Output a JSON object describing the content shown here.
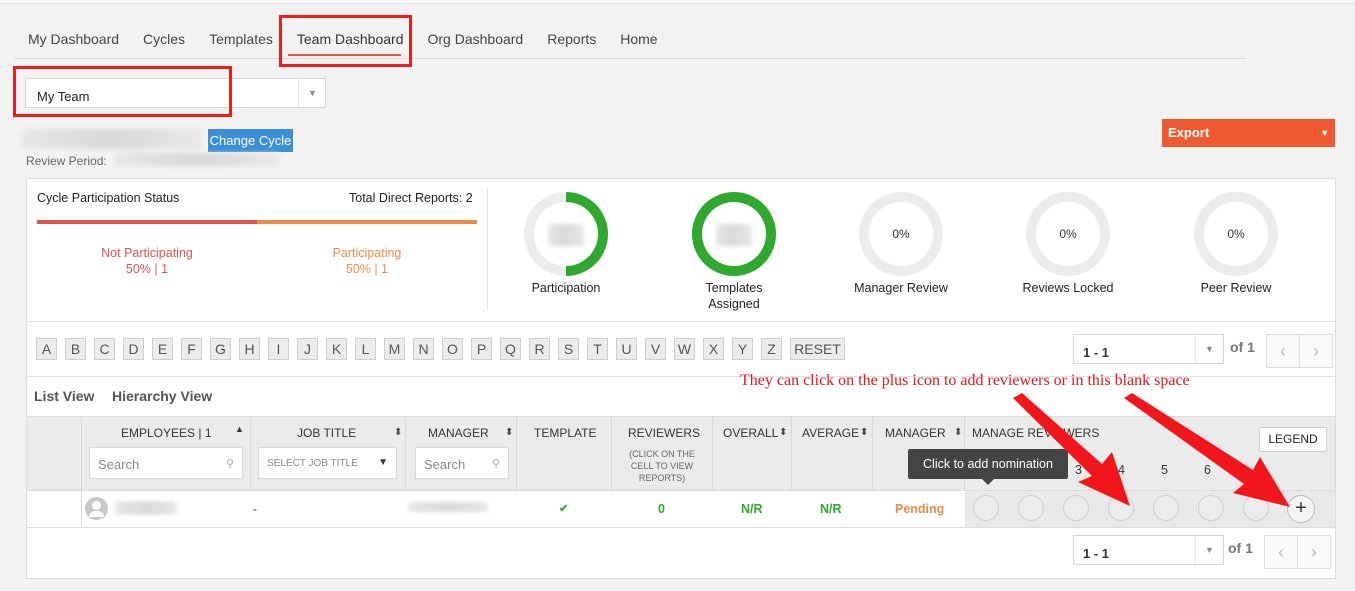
{
  "nav": {
    "tabs": [
      "My Dashboard",
      "Cycles",
      "Templates",
      "Team Dashboard",
      "Org Dashboard",
      "Reports",
      "Home"
    ],
    "active": "Team Dashboard"
  },
  "team_select": {
    "value": "My Team"
  },
  "cycle": {
    "change_label": "Change Cycle",
    "review_period_label": "Review Period:"
  },
  "export": {
    "label": "Export"
  },
  "participation": {
    "title": "Cycle Participation Status",
    "total": "Total Direct Reports: 2",
    "not_participating": {
      "label": "Not Participating",
      "value": "50% | 1"
    },
    "participating": {
      "label": "Participating",
      "value": "50% | 1"
    }
  },
  "stats": [
    {
      "label": "Participation",
      "value": "",
      "fill": 0.5
    },
    {
      "label": "Templates Assigned",
      "value": "",
      "fill": 1.0
    },
    {
      "label": "Manager Review",
      "value": "0%",
      "fill": 0
    },
    {
      "label": "Reviews Locked",
      "value": "0%",
      "fill": 0
    },
    {
      "label": "Peer Review",
      "value": "0%",
      "fill": 0
    }
  ],
  "letters": [
    "A",
    "B",
    "C",
    "D",
    "E",
    "F",
    "G",
    "H",
    "I",
    "J",
    "K",
    "L",
    "M",
    "N",
    "O",
    "P",
    "Q",
    "R",
    "S",
    "T",
    "U",
    "V",
    "W",
    "X",
    "Y",
    "Z"
  ],
  "reset_label": "RESET",
  "pager": {
    "range": "1 - 1",
    "of": "of 1"
  },
  "views": {
    "list": "List View",
    "hierarchy": "Hierarchy View"
  },
  "annotation": "They can click on the plus icon to add reviewers or in this blank space",
  "table": {
    "headers": {
      "employees": "EMPLOYEES | 1",
      "job_title": "JOB TITLE",
      "manager": "MANAGER",
      "template": "TEMPLATE",
      "reviewers": "REVIEWERS",
      "reviewers_note": "(CLICK ON THE CELL TO VIEW REPORTS)",
      "overall": "OVERALL",
      "average": "AVERAGE",
      "manager_status": "MANAGER",
      "manage_reviewers": "MANAGE REVIEWERS"
    },
    "filters": {
      "employees_placeholder": "Search",
      "job_title_placeholder": "SELECT JOB TITLE",
      "manager_placeholder": "Search"
    },
    "legend_label": "LEGEND",
    "slot_numbers": [
      "3",
      "4",
      "5",
      "6"
    ],
    "tooltip": "Click to add nomination",
    "row": {
      "job_title": "-",
      "template": "✔",
      "reviewers": "0",
      "overall": "N/R",
      "average": "N/R",
      "manager_status": "Pending"
    },
    "plus_label": "+"
  },
  "colors": {
    "accent": "#e8553a",
    "green": "#2ea82e",
    "orange": "#ee8b4b",
    "red": "#e0544f",
    "blue": "#3a8fd6"
  }
}
